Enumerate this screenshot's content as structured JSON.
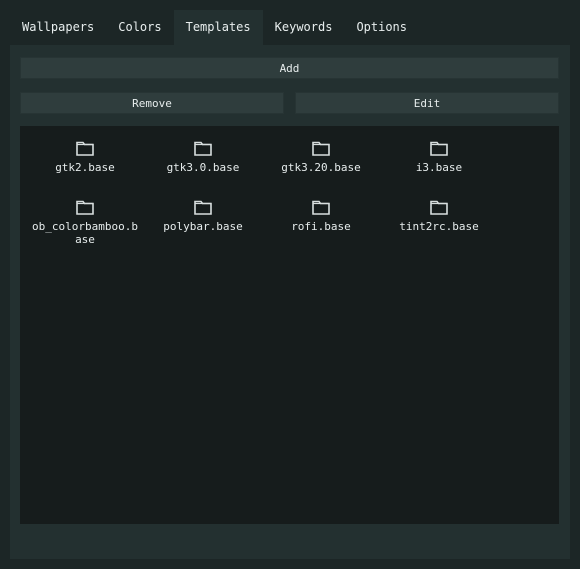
{
  "tabs": [
    {
      "label": "Wallpapers",
      "active": false
    },
    {
      "label": "Colors",
      "active": false
    },
    {
      "label": "Templates",
      "active": true
    },
    {
      "label": "Keywords",
      "active": false
    },
    {
      "label": "Options",
      "active": false
    }
  ],
  "toolbar": {
    "add_label": "Add",
    "remove_label": "Remove",
    "edit_label": "Edit"
  },
  "templates": [
    {
      "name": "gtk2.base",
      "icon": "folder-icon"
    },
    {
      "name": "gtk3.0.base",
      "icon": "folder-icon"
    },
    {
      "name": "gtk3.20.base",
      "icon": "folder-icon"
    },
    {
      "name": "i3.base",
      "icon": "folder-icon"
    },
    {
      "name": "ob_colorbamboo.base",
      "icon": "folder-icon"
    },
    {
      "name": "polybar.base",
      "icon": "folder-icon"
    },
    {
      "name": "rofi.base",
      "icon": "folder-icon"
    },
    {
      "name": "tint2rc.base",
      "icon": "folder-icon"
    }
  ],
  "colors": {
    "background": "#1c2626",
    "panel": "#233030",
    "button": "#2f3d3d",
    "file_area": "#161c1c",
    "text": "#e6ecec"
  }
}
